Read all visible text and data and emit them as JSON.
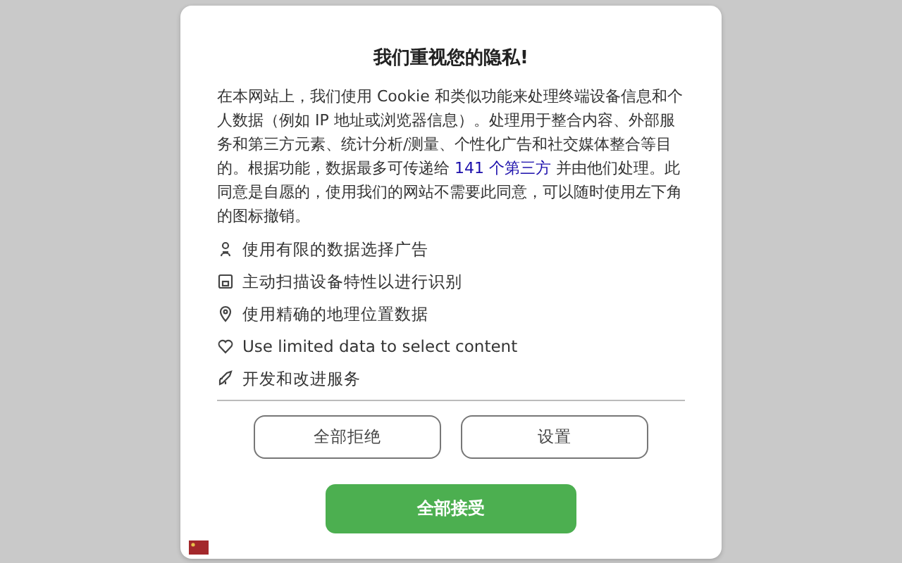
{
  "dialog": {
    "title": "我们重视您的隐私!",
    "body": {
      "before": "在本网站上，我们使用 Cookie 和类似功能来处理终端设备信息和个人数据（例如 IP 地址或浏览器信息）。处理用于整合内容、外部服务和第三方元素、统计分析/测量、个性化广告和社交媒体整合等目的。根据功能，数据最多可传递给 ",
      "link": "141 个第三方",
      "after": " 并由他们处理。此同意是自愿的，使用我们的网站不需要此同意，可以随时使用左下角的图标撤销。"
    },
    "purposes": [
      {
        "label": "使用有限的数据选择广告"
      },
      {
        "label": "主动扫描设备特性以进行识别"
      },
      {
        "label": "使用精确的地理位置数据"
      },
      {
        "label": "Use limited data to select content"
      },
      {
        "label": "开发和改进服务"
      }
    ],
    "buttons": [
      {
        "label": "全部拒绝"
      },
      {
        "label": "设置"
      }
    ],
    "accept_button": {
      "label": "全部接受"
    }
  }
}
